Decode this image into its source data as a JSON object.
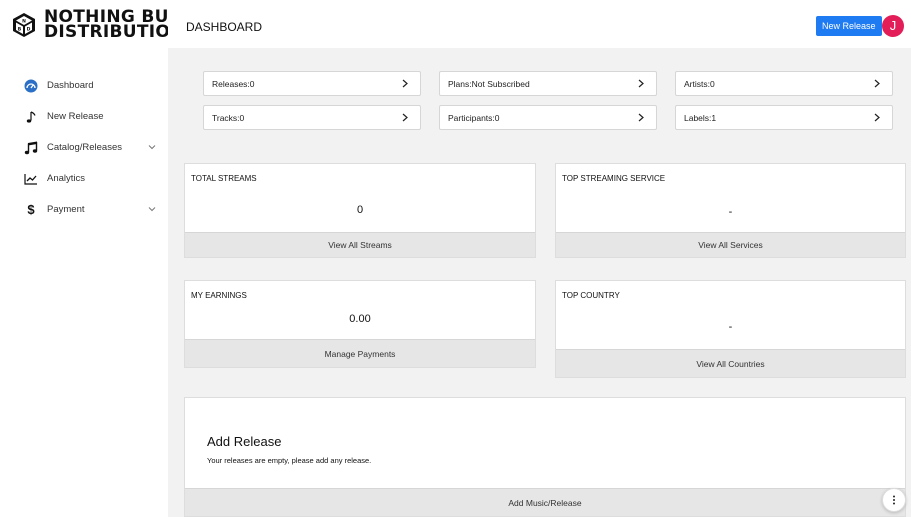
{
  "brand": {
    "line1": "NOTHING BUT",
    "line2": "DISTRIBUTION"
  },
  "header": {
    "title": "DASHBOARD",
    "new_release_label": "New Release",
    "avatar_initial": "J"
  },
  "sidebar": {
    "items": [
      {
        "label": "Dashboard",
        "icon": "dashboard-gauge-icon"
      },
      {
        "label": "New Release",
        "icon": "music-note-icon"
      },
      {
        "label": "Catalog/Releases",
        "icon": "music-notes-icon",
        "has_chevron": true
      },
      {
        "label": "Analytics",
        "icon": "chart-line-icon"
      },
      {
        "label": "Payment",
        "icon": "dollar-icon",
        "has_chevron": true
      }
    ]
  },
  "stats": [
    {
      "label": "Releases:0"
    },
    {
      "label": "Plans:Not Subscribed"
    },
    {
      "label": "Artists:0"
    },
    {
      "label": "Tracks:0"
    },
    {
      "label": "Participants:0"
    },
    {
      "label": "Labels:1"
    }
  ],
  "cards": {
    "total_streams": {
      "title": "TOTAL STREAMS",
      "value": "0",
      "footer": "View All Streams"
    },
    "top_service": {
      "title": "TOP STREAMING SERVICE",
      "value": "-",
      "footer": "View All Services"
    },
    "earnings": {
      "title": "MY EARNINGS",
      "value": "0.00",
      "footer": "Manage Payments"
    },
    "top_country": {
      "title": "TOP COUNTRY",
      "value": "-",
      "footer": "View All Countries"
    }
  },
  "add_release": {
    "title": "Add Release",
    "description": "Your releases are empty, please add any release.",
    "footer": "Add Music/Release"
  },
  "colors": {
    "primary": "#1e7bf2",
    "avatar": "#e21d57",
    "background": "#f2f2f2"
  }
}
